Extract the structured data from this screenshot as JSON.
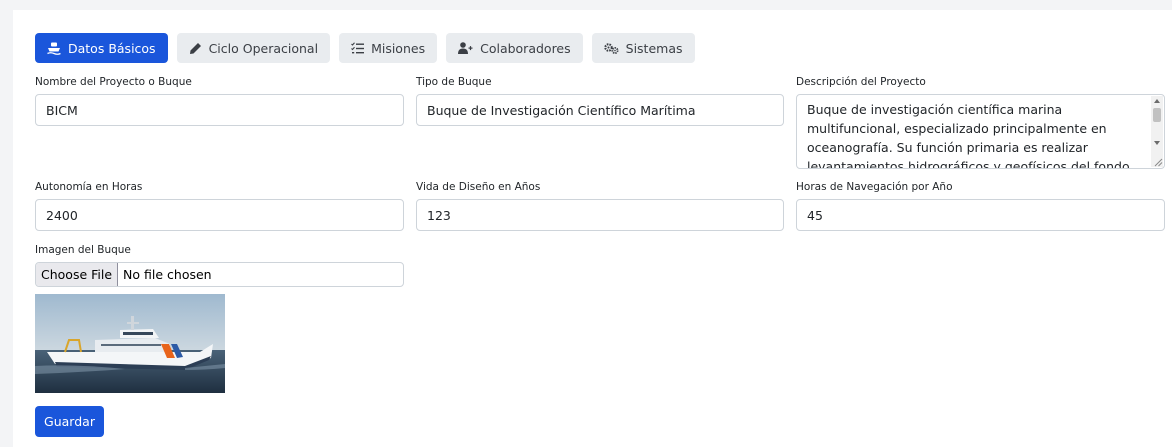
{
  "tabs": [
    {
      "label": "Datos Básicos",
      "icon": "ship-icon",
      "active": true
    },
    {
      "label": "Ciclo Operacional",
      "icon": "pen-icon",
      "active": false
    },
    {
      "label": "Misiones",
      "icon": "list-check-icon",
      "active": false
    },
    {
      "label": "Colaboradores",
      "icon": "user-plus-icon",
      "active": false
    },
    {
      "label": "Sistemas",
      "icon": "gears-icon",
      "active": false
    }
  ],
  "fields": {
    "project_name": {
      "label": "Nombre del Proyecto o Buque",
      "value": "BICM"
    },
    "ship_type": {
      "label": "Tipo de Buque",
      "value": "Buque de Investigación Científico Marítima"
    },
    "description": {
      "label": "Descripción del Proyecto",
      "value": "Buque de investigación científica marina multifuncional, especializado principalmente en oceanografía. Su función primaria es realizar levantamientos hidrográficos y geofísicos del fondo marino. Además, está equipado para"
    },
    "autonomy_hours": {
      "label": "Autonomía en Horas",
      "value": "2400"
    },
    "design_life_years": {
      "label": "Vida de Diseño en Años",
      "value": "123"
    },
    "navigation_hours_per_year": {
      "label": "Horas de Navegación por Año",
      "value": "45"
    }
  },
  "image": {
    "label": "Imagen del Buque",
    "choose_label": "Choose File",
    "status": "No file chosen"
  },
  "save_label": "Guardar",
  "colors": {
    "primary": "#1a56db",
    "tab_bg": "#e9ecef",
    "page_bg": "#f3f4f6"
  }
}
